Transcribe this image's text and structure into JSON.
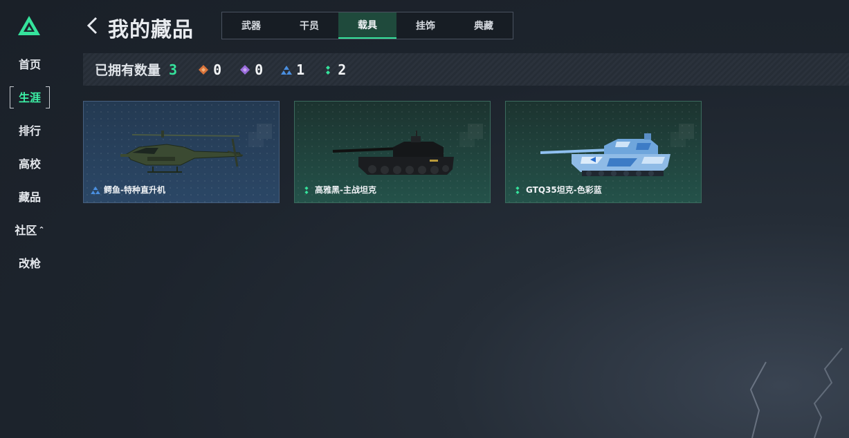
{
  "sidebar": {
    "items": [
      {
        "label": "首页"
      },
      {
        "label": "生涯"
      },
      {
        "label": "排行"
      },
      {
        "label": "高校"
      },
      {
        "label": "藏品"
      },
      {
        "label": "社区",
        "caret": "⌃"
      },
      {
        "label": "改枪"
      }
    ]
  },
  "header": {
    "title": "我的藏品"
  },
  "tabs": [
    {
      "label": "武器"
    },
    {
      "label": "干员"
    },
    {
      "label": "载具"
    },
    {
      "label": "挂饰"
    },
    {
      "label": "典藏"
    }
  ],
  "active_tab": "载具",
  "active_nav": "生涯",
  "stats": {
    "label": "已拥有数量",
    "total": "3",
    "rarities": [
      {
        "icon": "orange-diamond-icon",
        "color": "#d9733a",
        "count": "0"
      },
      {
        "icon": "purple-diamond-icon",
        "color": "#9a6cdc",
        "count": "0"
      },
      {
        "icon": "blue-triangle-icon",
        "color": "#4a8fe0",
        "count": "1"
      },
      {
        "icon": "green-dots-icon",
        "color": "#35e39c",
        "count": "2"
      }
    ]
  },
  "items": [
    {
      "name": "鳄鱼-特种直升机",
      "rarity": "blue",
      "image": "attack-helicopter"
    },
    {
      "name": "高雅黑-主战坦克",
      "rarity": "green",
      "image": "black-tank"
    },
    {
      "name": "GTQ35坦克-色彩蓝",
      "rarity": "green",
      "image": "blue-camo-tank"
    }
  ],
  "colors": {
    "accent": "#35e39c",
    "background": "#1d242d"
  }
}
